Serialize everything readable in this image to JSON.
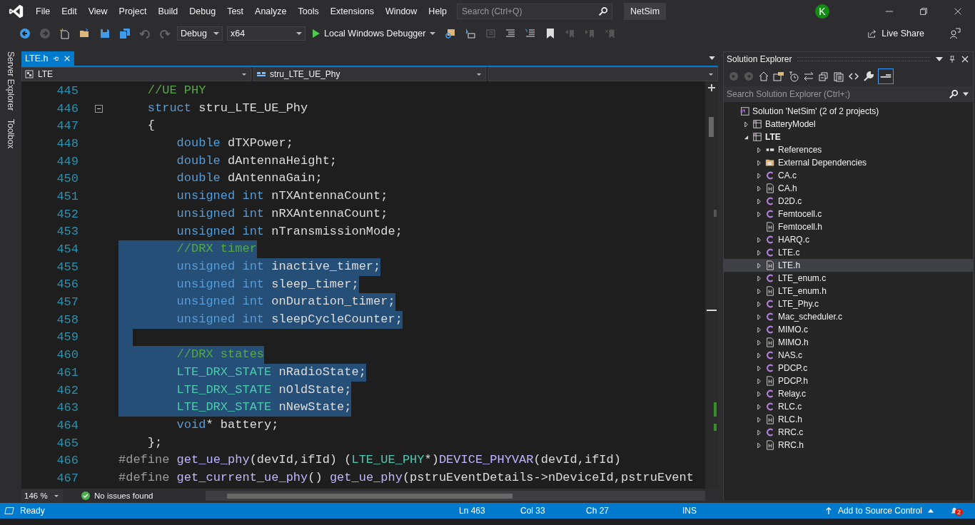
{
  "title_bar": {
    "menu": [
      "File",
      "Edit",
      "View",
      "Project",
      "Build",
      "Debug",
      "Test",
      "Analyze",
      "Tools",
      "Extensions",
      "Window",
      "Help"
    ],
    "search": {
      "placeholder": "Search (Ctrl+Q)"
    },
    "solution_name": "NetSim",
    "avatar": "K"
  },
  "toolbar": {
    "configuration": "Debug",
    "platform": "x64",
    "debugger": "Local Windows Debugger",
    "live_share": "Live Share"
  },
  "side_tabs": [
    "Server Explorer",
    "Toolbox"
  ],
  "document_tabs": [
    {
      "label": "LTE.h",
      "selected": true
    }
  ],
  "nav_bar": {
    "project": "LTE",
    "scope": "stru_LTE_UE_Phy"
  },
  "code_lines": [
    {
      "number": "445",
      "selected": false,
      "tokens": [
        {
          "kind": "comment",
          "text": "    //UE PHY"
        }
      ]
    },
    {
      "number": "446",
      "selected": false,
      "fold_expanded": true,
      "tokens": [
        {
          "kind": "keyword",
          "text": "    struct"
        },
        {
          "kind": "plain",
          "text": " stru_LTE_UE_Phy"
        }
      ]
    },
    {
      "number": "447",
      "selected": false,
      "tokens": [
        {
          "kind": "plain",
          "text": "    {"
        }
      ]
    },
    {
      "number": "448",
      "selected": false,
      "tokens": [
        {
          "kind": "keyword",
          "text": "        double"
        },
        {
          "kind": "plain",
          "text": " dTXPower;"
        }
      ]
    },
    {
      "number": "449",
      "selected": false,
      "tokens": [
        {
          "kind": "keyword",
          "text": "        double"
        },
        {
          "kind": "plain",
          "text": " dAntennaHeight;"
        }
      ]
    },
    {
      "number": "450",
      "selected": false,
      "tokens": [
        {
          "kind": "keyword",
          "text": "        double"
        },
        {
          "kind": "plain",
          "text": " dAntennaGain;"
        }
      ]
    },
    {
      "number": "451",
      "selected": false,
      "tokens": [
        {
          "kind": "keyword",
          "text": "        unsigned int"
        },
        {
          "kind": "plain",
          "text": " nTXAntennaCount;"
        }
      ]
    },
    {
      "number": "452",
      "selected": false,
      "tokens": [
        {
          "kind": "keyword",
          "text": "        unsigned int"
        },
        {
          "kind": "plain",
          "text": " nRXAntennaCount;"
        }
      ]
    },
    {
      "number": "453",
      "selected": false,
      "tokens": [
        {
          "kind": "keyword",
          "text": "        unsigned int"
        },
        {
          "kind": "plain",
          "text": " nTransmissionMode;"
        }
      ]
    },
    {
      "number": "454",
      "selected": true,
      "tokens": [
        {
          "kind": "comment",
          "text": "        //DRX timer"
        }
      ]
    },
    {
      "number": "455",
      "selected": true,
      "tokens": [
        {
          "kind": "keyword",
          "text": "        unsigned int"
        },
        {
          "kind": "plain",
          "text": " inactive_timer;"
        }
      ]
    },
    {
      "number": "456",
      "selected": true,
      "tokens": [
        {
          "kind": "keyword",
          "text": "        unsigned int"
        },
        {
          "kind": "plain",
          "text": " sleep_timer;"
        }
      ]
    },
    {
      "number": "457",
      "selected": true,
      "tokens": [
        {
          "kind": "keyword",
          "text": "        unsigned int"
        },
        {
          "kind": "plain",
          "text": " onDuration_timer;"
        }
      ]
    },
    {
      "number": "458",
      "selected": true,
      "tokens": [
        {
          "kind": "keyword",
          "text": "        unsigned int"
        },
        {
          "kind": "plain",
          "text": " sleepCycleCounter;"
        }
      ]
    },
    {
      "number": "459",
      "selected": true
    },
    {
      "number": "460",
      "selected": true,
      "tokens": [
        {
          "kind": "comment",
          "text": "        //DRX states"
        }
      ]
    },
    {
      "number": "461",
      "selected": true,
      "tokens": [
        {
          "kind": "type",
          "text": "        LTE_DRX_STATE"
        },
        {
          "kind": "plain",
          "text": " nRadioState;"
        }
      ]
    },
    {
      "number": "462",
      "selected": true,
      "tokens": [
        {
          "kind": "type",
          "text": "        LTE_DRX_STATE"
        },
        {
          "kind": "plain",
          "text": " nOldState;"
        }
      ]
    },
    {
      "number": "463",
      "selected": true,
      "tokens": [
        {
          "kind": "type",
          "text": "        LTE_DRX_STATE"
        },
        {
          "kind": "plain",
          "text": " nNewState;"
        }
      ]
    },
    {
      "number": "464",
      "selected": false,
      "tokens": [
        {
          "kind": "keyword",
          "text": "        void"
        },
        {
          "kind": "plain",
          "text": "* battery;"
        }
      ]
    },
    {
      "number": "465",
      "selected": false,
      "tokens": [
        {
          "kind": "plain",
          "text": "    };"
        }
      ]
    },
    {
      "number": "466",
      "selected": false,
      "tokens": [
        {
          "kind": "preprocessor",
          "text": "#define"
        },
        {
          "kind": "macro",
          "text": " get_ue_phy"
        },
        {
          "kind": "plain",
          "text": "(devId,ifId) ("
        },
        {
          "kind": "type",
          "text": "LTE_UE_PHY"
        },
        {
          "kind": "plain",
          "text": "*)"
        },
        {
          "kind": "macro",
          "text": "DEVICE_PHYVAR"
        },
        {
          "kind": "plain",
          "text": "(devId,ifId)"
        }
      ]
    },
    {
      "number": "467",
      "selected": false,
      "tokens": [
        {
          "kind": "preprocessor",
          "text": "#define"
        },
        {
          "kind": "macro",
          "text": " get_current_ue_phy"
        },
        {
          "kind": "plain",
          "text": "() "
        },
        {
          "kind": "macro",
          "text": "get_ue_phy"
        },
        {
          "kind": "plain",
          "text": "(pstruEventDetails->nDeviceId,pstruEvent"
        }
      ]
    }
  ],
  "editor_footer": {
    "zoom": "146 %",
    "issues": "No issues found"
  },
  "solution_explorer": {
    "title": "Solution Explorer",
    "search": {
      "placeholder": "Search Solution Explorer (Ctrl+;)"
    },
    "tree": [
      {
        "label": "Solution 'NetSim' (2 of 2 projects)",
        "kind": "solution",
        "selected": false,
        "children": [
          {
            "label": "BatteryModel",
            "kind": "project",
            "expanded": false,
            "startup": false,
            "selected": false
          },
          {
            "label": "LTE",
            "kind": "project",
            "expanded": true,
            "startup": true,
            "selected": false,
            "children": [
              {
                "label": "References",
                "kind": "references",
                "expanded": false,
                "selected": false
              },
              {
                "label": "External Dependencies",
                "kind": "folder",
                "expanded": false,
                "selected": false
              },
              {
                "label": "CA.c",
                "kind": "c",
                "expanded": false,
                "selected": false
              },
              {
                "label": "CA.h",
                "kind": "h",
                "expanded": false,
                "selected": false
              },
              {
                "label": "D2D.c",
                "kind": "c",
                "expanded": false,
                "selected": false
              },
              {
                "label": "Femtocell.c",
                "kind": "c",
                "expanded": false,
                "selected": false
              },
              {
                "label": "Femtocell.h",
                "kind": "h",
                "selected": false
              },
              {
                "label": "HARQ.c",
                "kind": "c",
                "expanded": false,
                "selected": false
              },
              {
                "label": "LTE.c",
                "kind": "c",
                "expanded": false,
                "selected": false
              },
              {
                "label": "LTE.h",
                "kind": "h",
                "expanded": false,
                "selected": true
              },
              {
                "label": "LTE_enum.c",
                "kind": "c",
                "expanded": false,
                "selected": false
              },
              {
                "label": "LTE_enum.h",
                "kind": "h",
                "expanded": false,
                "selected": false
              },
              {
                "label": "LTE_Phy.c",
                "kind": "c",
                "expanded": false,
                "selected": false
              },
              {
                "label": "Mac_scheduler.c",
                "kind": "c",
                "expanded": false,
                "selected": false
              },
              {
                "label": "MIMO.c",
                "kind": "c",
                "expanded": false,
                "selected": false
              },
              {
                "label": "MIMO.h",
                "kind": "h",
                "expanded": false,
                "selected": false
              },
              {
                "label": "NAS.c",
                "kind": "c",
                "expanded": false,
                "selected": false
              },
              {
                "label": "PDCP.c",
                "kind": "c",
                "expanded": false,
                "selected": false
              },
              {
                "label": "PDCP.h",
                "kind": "h",
                "expanded": false,
                "selected": false
              },
              {
                "label": "Relay.c",
                "kind": "c",
                "expanded": false,
                "selected": false
              },
              {
                "label": "RLC.c",
                "kind": "c",
                "expanded": false,
                "selected": false
              },
              {
                "label": "RLC.h",
                "kind": "h",
                "expanded": false,
                "selected": false
              },
              {
                "label": "RRC.c",
                "kind": "c",
                "expanded": false,
                "selected": false
              },
              {
                "label": "RRC.h",
                "kind": "h",
                "expanded": false,
                "selected": false
              }
            ]
          }
        ]
      }
    ]
  },
  "status_bar": {
    "state": "Ready",
    "line": "Ln 463",
    "col": "Col 33",
    "ch": "Ch 27",
    "mode": "INS",
    "source_control": "Add to Source Control",
    "notifications": "2"
  }
}
